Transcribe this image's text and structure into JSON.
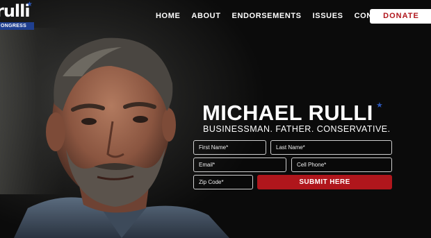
{
  "logo": {
    "wordmark": "rulli",
    "band_text": "ONGRESS",
    "star_icon": "star-icon",
    "accent": "#1f3f8f"
  },
  "nav": {
    "items": [
      {
        "label": "HOME"
      },
      {
        "label": "ABOUT"
      },
      {
        "label": "ENDORSEMENTS"
      },
      {
        "label": "ISSUES"
      },
      {
        "label": "CONTACT"
      }
    ],
    "donate_label": "DONATE"
  },
  "hero": {
    "name": "MICHAEL RULLI",
    "tagline": "BUSINESSMAN. FATHER. CONSERVATIVE."
  },
  "form": {
    "first_name_placeholder": "First Name*",
    "last_name_placeholder": "Last Name*",
    "email_placeholder": "Email*",
    "cell_phone_placeholder": "Cell Phone*",
    "zip_placeholder": "Zip Code*",
    "submit_label": "SUBMIT HERE"
  },
  "colors": {
    "brand_red": "#b0161c",
    "brand_blue": "#2c57b8",
    "background": "#0d0d0d"
  }
}
